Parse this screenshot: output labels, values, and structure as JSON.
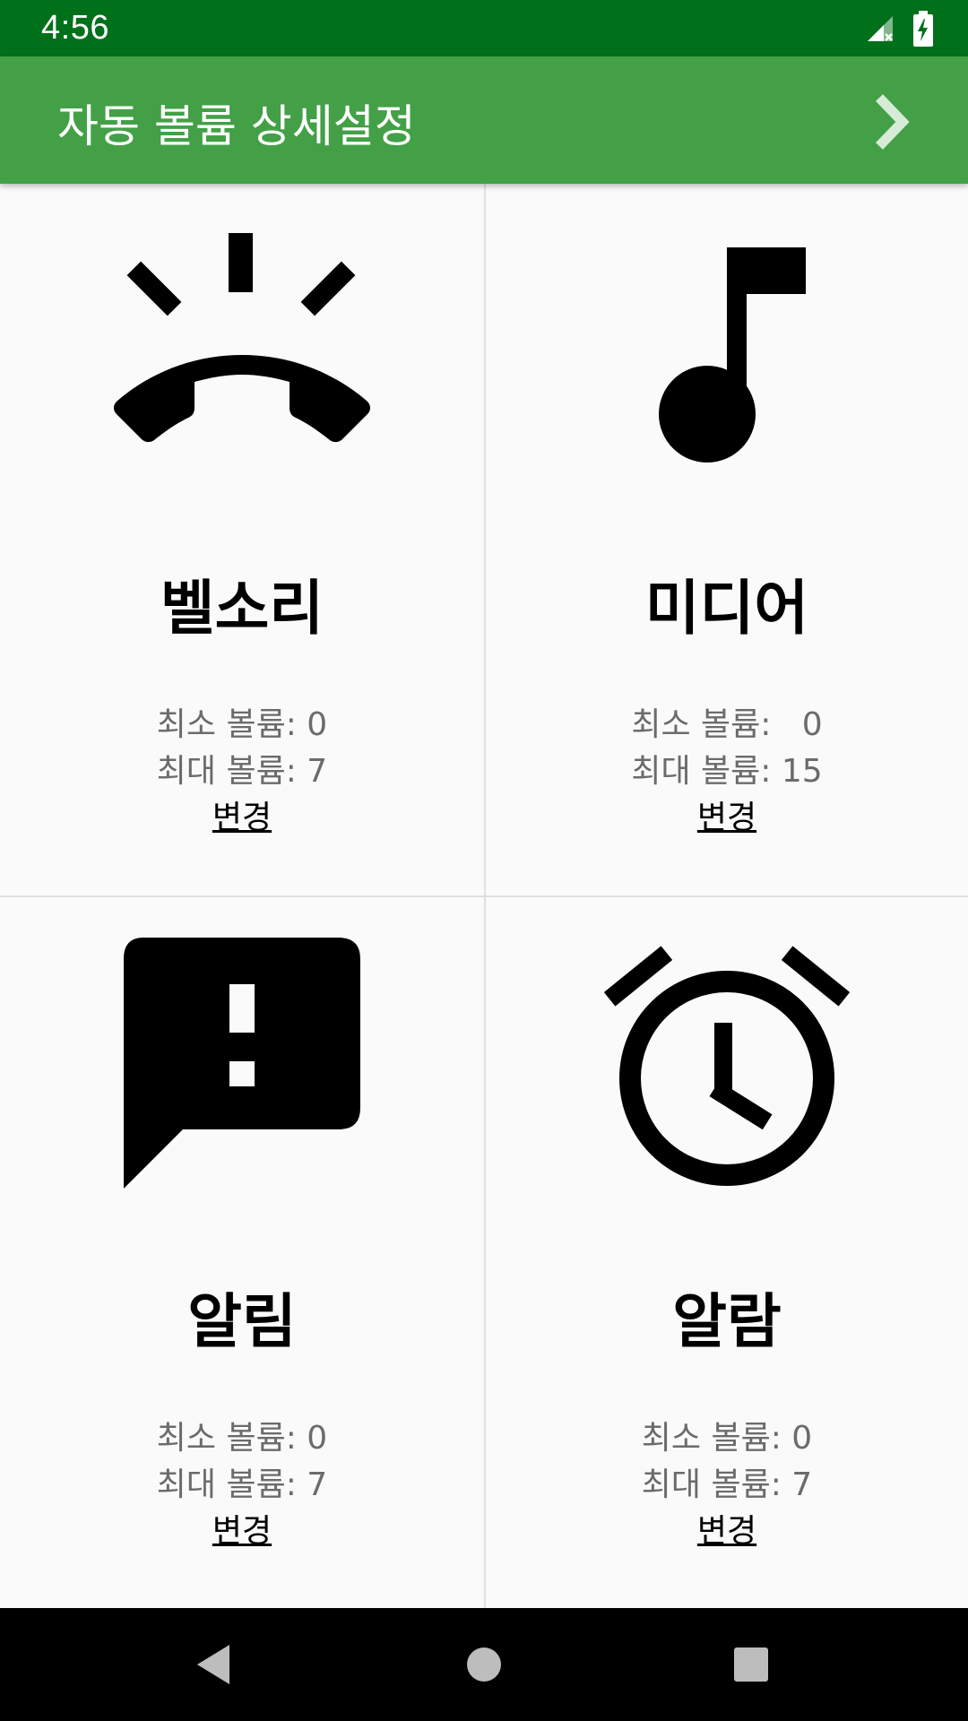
{
  "status_bar": {
    "time": "4:56",
    "icons": [
      "cell-signal-off-icon",
      "battery-charging-icon"
    ]
  },
  "app_bar": {
    "title": "자동 볼륨 상세설정",
    "next_icon": "chevron-right-icon"
  },
  "cards": [
    {
      "title": "벨소리",
      "icon": "ringer-phone-icon",
      "min_label": "최소 볼륨: 0",
      "max_label": "최대 볼륨: 7",
      "change_label": "변경"
    },
    {
      "title": "미디어",
      "icon": "music-note-icon",
      "min_label": "최소 볼륨:   0",
      "max_label": "최대 볼륨: 15",
      "change_label": "변경"
    },
    {
      "title": "알림",
      "icon": "notification-alert-icon",
      "min_label": "최소 볼륨: 0",
      "max_label": "최대 볼륨: 7",
      "change_label": "변경"
    },
    {
      "title": "알람",
      "icon": "alarm-clock-icon",
      "min_label": "최소 볼륨: 0",
      "max_label": "최대 볼륨: 7",
      "change_label": "변경"
    }
  ],
  "nav_bar": {
    "icons": [
      "back-icon",
      "home-icon",
      "recents-icon"
    ]
  },
  "colors": {
    "status_bar": "#00701a",
    "app_bar": "#43a047",
    "background": "#fafafa",
    "secondary_text": "#6b6b6b"
  }
}
